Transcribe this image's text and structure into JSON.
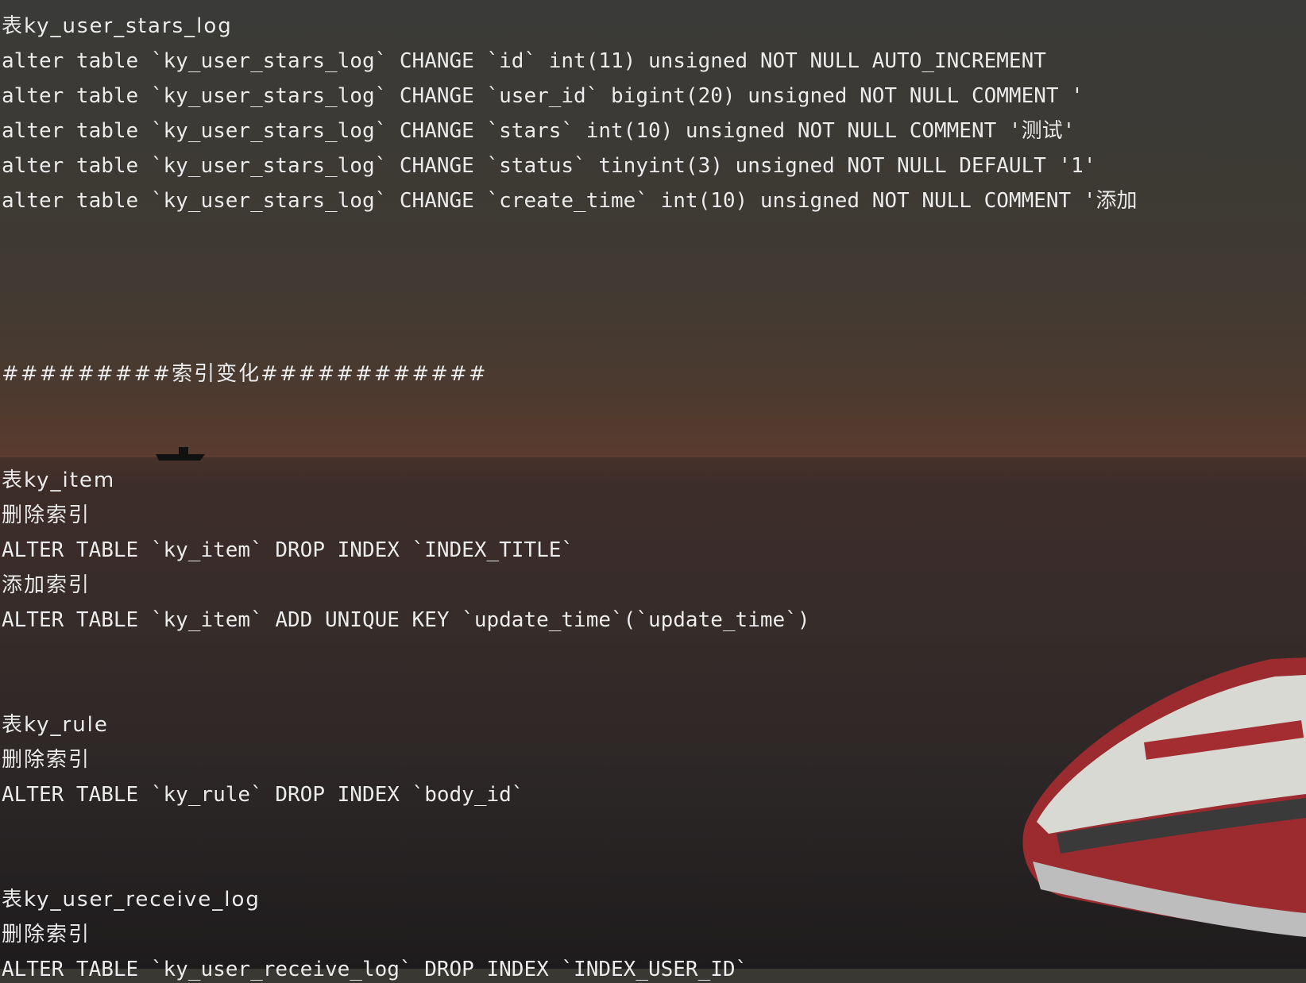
{
  "terminal": {
    "column_changes": {
      "table_title": "表ky_user_stars_log",
      "statements": [
        "alter table `ky_user_stars_log` CHANGE `id` int(11) unsigned NOT NULL AUTO_INCREMENT",
        "alter table `ky_user_stars_log` CHANGE `user_id` bigint(20) unsigned NOT NULL COMMENT '",
        "alter table `ky_user_stars_log` CHANGE `stars` int(10) unsigned NOT NULL COMMENT '测试'",
        "alter table `ky_user_stars_log` CHANGE `status` tinyint(3) unsigned NOT NULL DEFAULT '1' ",
        "alter table `ky_user_stars_log` CHANGE `create_time` int(10) unsigned NOT NULL COMMENT '添加"
      ]
    },
    "index_header": "#########索引变化############",
    "index_blocks": [
      {
        "table_title": "表ky_item",
        "drop_label": "删除索引",
        "drop_sql": "ALTER TABLE `ky_item` DROP INDEX `INDEX_TITLE`",
        "add_label": "添加索引",
        "add_sql": "ALTER TABLE `ky_item` ADD UNIQUE KEY `update_time`(`update_time`)"
      },
      {
        "table_title": "表ky_rule",
        "drop_label": "删除索引",
        "drop_sql": "ALTER TABLE `ky_rule` DROP INDEX `body_id`"
      },
      {
        "table_title": "表ky_user_receive_log",
        "drop_label": "删除索引",
        "drop_sql": "ALTER TABLE `ky_user_receive_log` DROP INDEX `INDEX_USER_ID`"
      }
    ]
  }
}
